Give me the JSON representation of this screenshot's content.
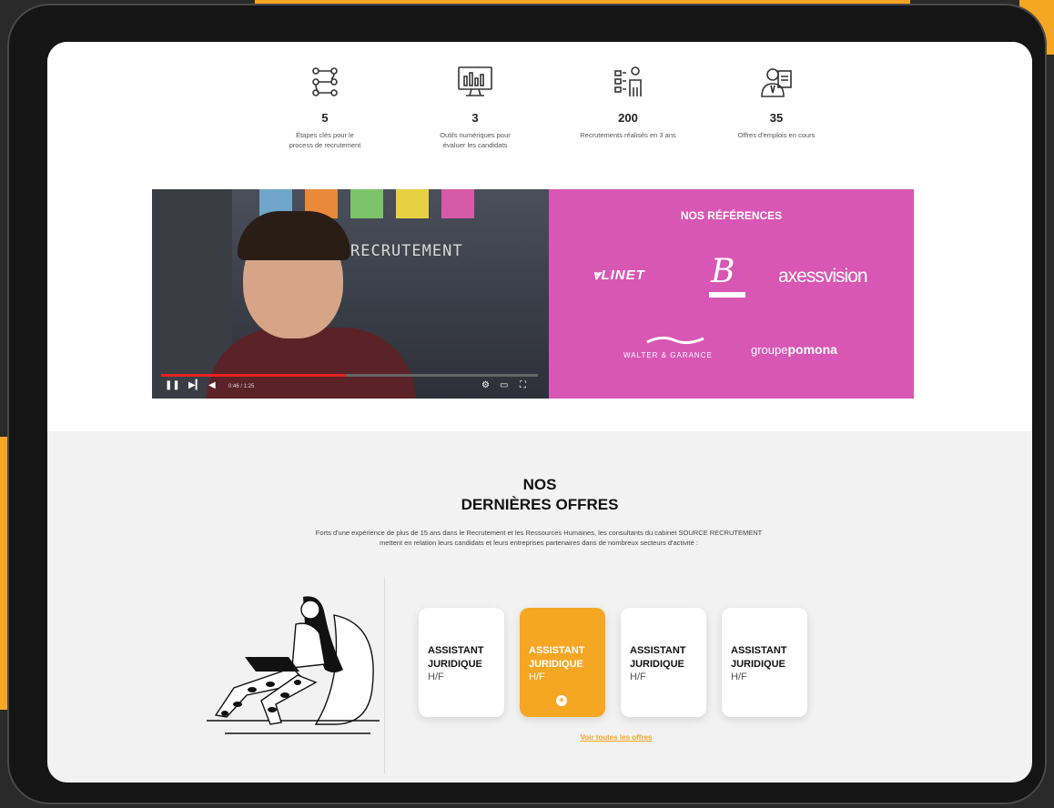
{
  "stats": [
    {
      "icon": "process-steps-icon",
      "number": "5",
      "label_line1": "Étapes clés pour le",
      "label_line2": "process de recrutement"
    },
    {
      "icon": "digital-tools-icon",
      "number": "3",
      "label_line1": "Outils numériques pour",
      "label_line2": "évaluer les candidats"
    },
    {
      "icon": "recruitments-icon",
      "number": "200",
      "label_line1": "Recrutements réalisés en 3 ans",
      "label_line2": ""
    },
    {
      "icon": "job-offers-icon",
      "number": "35",
      "label_line1": "Offres d'emplois en cours",
      "label_line2": ""
    }
  ],
  "video": {
    "wall_text": "RECRUTEMENT",
    "time": "0:46 / 1:25",
    "progress_fraction": 0.49
  },
  "references": {
    "title": "NOS RÉFÉRENCES",
    "logos": [
      {
        "name": "linet-logo",
        "text": "LINET"
      },
      {
        "name": "b-logo",
        "text": "B"
      },
      {
        "name": "axess-vision-logo",
        "text": "axessvision"
      },
      {
        "name": "walter-garance-logo",
        "text": "WALTER & GARANCE"
      },
      {
        "name": "groupe-pomona-logo",
        "text_a": "groupe",
        "text_b": "pomona"
      }
    ]
  },
  "offers": {
    "title_line1": "NOS",
    "title_line2": "DERNIÈRES OFFRES",
    "description_line1": "Forts d'une expérience de plus de 15 ans dans le Recrutement et les Ressources Humaines, les consultants du cabinet SOURCE RECRUTEMENT",
    "description_line2": "mettent en relation leurs candidats et leurs entreprises partenaires dans de nombreux secteurs d'activité :",
    "cards": [
      {
        "title_line1": "ASSISTANT",
        "title_line2": "JURIDIQUE",
        "suffix": "H/F",
        "active": false
      },
      {
        "title_line1": "ASSISTANT",
        "title_line2": "JURIDIQUE",
        "suffix": "H/F",
        "active": true,
        "action": "+"
      },
      {
        "title_line1": "ASSISTANT",
        "title_line2": "JURIDIQUE",
        "suffix": "H/F",
        "active": false
      },
      {
        "title_line1": "ASSISTANT",
        "title_line2": "JURIDIQUE",
        "suffix": "H/F",
        "active": false
      }
    ],
    "see_all": "Voir toutes les offres"
  },
  "colors": {
    "accent": "#f5a623",
    "references_bg": "#d857b4"
  }
}
